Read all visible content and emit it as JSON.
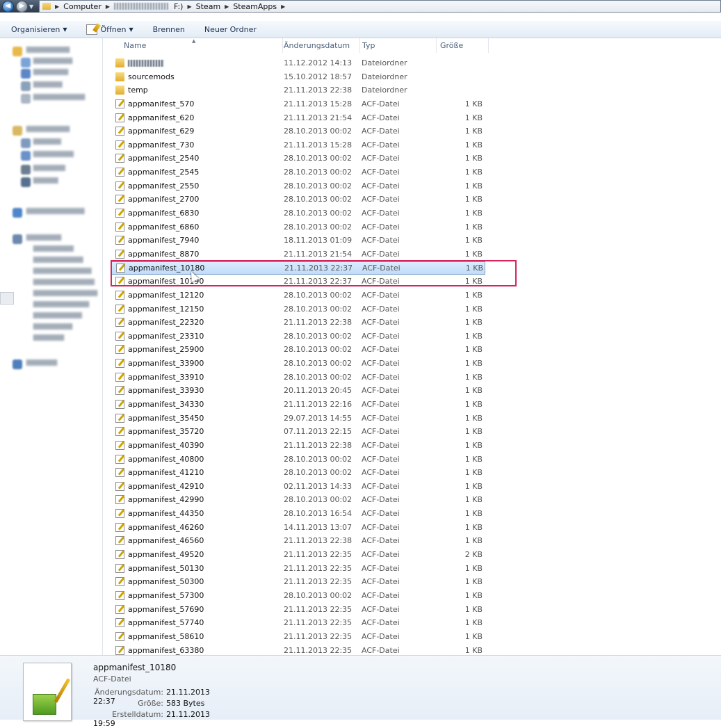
{
  "address": {
    "crumbs": [
      "Computer",
      "F:)",
      "Steam",
      "SteamApps"
    ]
  },
  "toolbar": {
    "organize": "Organisieren",
    "open": "Öffnen",
    "burn": "Brennen",
    "new_folder": "Neuer Ordner"
  },
  "columns": {
    "name": "Name",
    "date": "Änderungsdatum",
    "type": "Typ",
    "size": "Größe"
  },
  "files": [
    {
      "name": "",
      "blurred": true,
      "date": "11.12.2012 14:13",
      "type": "Dateiordner",
      "size": "",
      "kind": "folder"
    },
    {
      "name": "sourcemods",
      "date": "15.10.2012 18:57",
      "type": "Dateiordner",
      "size": "",
      "kind": "folder"
    },
    {
      "name": "temp",
      "date": "21.11.2013 22:38",
      "type": "Dateiordner",
      "size": "",
      "kind": "folder"
    },
    {
      "name": "appmanifest_570",
      "date": "21.11.2013 15:28",
      "type": "ACF-Datei",
      "size": "1 KB",
      "kind": "file"
    },
    {
      "name": "appmanifest_620",
      "date": "21.11.2013 21:54",
      "type": "ACF-Datei",
      "size": "1 KB",
      "kind": "file"
    },
    {
      "name": "appmanifest_629",
      "date": "28.10.2013 00:02",
      "type": "ACF-Datei",
      "size": "1 KB",
      "kind": "file"
    },
    {
      "name": "appmanifest_730",
      "date": "21.11.2013 15:28",
      "type": "ACF-Datei",
      "size": "1 KB",
      "kind": "file"
    },
    {
      "name": "appmanifest_2540",
      "date": "28.10.2013 00:02",
      "type": "ACF-Datei",
      "size": "1 KB",
      "kind": "file"
    },
    {
      "name": "appmanifest_2545",
      "date": "28.10.2013 00:02",
      "type": "ACF-Datei",
      "size": "1 KB",
      "kind": "file"
    },
    {
      "name": "appmanifest_2550",
      "date": "28.10.2013 00:02",
      "type": "ACF-Datei",
      "size": "1 KB",
      "kind": "file"
    },
    {
      "name": "appmanifest_2700",
      "date": "28.10.2013 00:02",
      "type": "ACF-Datei",
      "size": "1 KB",
      "kind": "file"
    },
    {
      "name": "appmanifest_6830",
      "date": "28.10.2013 00:02",
      "type": "ACF-Datei",
      "size": "1 KB",
      "kind": "file"
    },
    {
      "name": "appmanifest_6860",
      "date": "28.10.2013 00:02",
      "type": "ACF-Datei",
      "size": "1 KB",
      "kind": "file"
    },
    {
      "name": "appmanifest_7940",
      "date": "18.11.2013 01:09",
      "type": "ACF-Datei",
      "size": "1 KB",
      "kind": "file"
    },
    {
      "name": "appmanifest_8870",
      "date": "21.11.2013 21:54",
      "type": "ACF-Datei",
      "size": "1 KB",
      "kind": "file"
    },
    {
      "name": "appmanifest_10180",
      "date": "21.11.2013 22:37",
      "type": "ACF-Datei",
      "size": "1 KB",
      "kind": "file",
      "selected": true
    },
    {
      "name": "appmanifest_10190",
      "date": "21.11.2013 22:37",
      "type": "ACF-Datei",
      "size": "1 KB",
      "kind": "file"
    },
    {
      "name": "appmanifest_12120",
      "date": "28.10.2013 00:02",
      "type": "ACF-Datei",
      "size": "1 KB",
      "kind": "file"
    },
    {
      "name": "appmanifest_12150",
      "date": "28.10.2013 00:02",
      "type": "ACF-Datei",
      "size": "1 KB",
      "kind": "file"
    },
    {
      "name": "appmanifest_22320",
      "date": "21.11.2013 22:38",
      "type": "ACF-Datei",
      "size": "1 KB",
      "kind": "file"
    },
    {
      "name": "appmanifest_23310",
      "date": "28.10.2013 00:02",
      "type": "ACF-Datei",
      "size": "1 KB",
      "kind": "file"
    },
    {
      "name": "appmanifest_25900",
      "date": "28.10.2013 00:02",
      "type": "ACF-Datei",
      "size": "1 KB",
      "kind": "file"
    },
    {
      "name": "appmanifest_33900",
      "date": "28.10.2013 00:02",
      "type": "ACF-Datei",
      "size": "1 KB",
      "kind": "file"
    },
    {
      "name": "appmanifest_33910",
      "date": "28.10.2013 00:02",
      "type": "ACF-Datei",
      "size": "1 KB",
      "kind": "file"
    },
    {
      "name": "appmanifest_33930",
      "date": "20.11.2013 20:45",
      "type": "ACF-Datei",
      "size": "1 KB",
      "kind": "file"
    },
    {
      "name": "appmanifest_34330",
      "date": "21.11.2013 22:16",
      "type": "ACF-Datei",
      "size": "1 KB",
      "kind": "file"
    },
    {
      "name": "appmanifest_35450",
      "date": "29.07.2013 14:55",
      "type": "ACF-Datei",
      "size": "1 KB",
      "kind": "file"
    },
    {
      "name": "appmanifest_35720",
      "date": "07.11.2013 22:15",
      "type": "ACF-Datei",
      "size": "1 KB",
      "kind": "file"
    },
    {
      "name": "appmanifest_40390",
      "date": "21.11.2013 22:38",
      "type": "ACF-Datei",
      "size": "1 KB",
      "kind": "file"
    },
    {
      "name": "appmanifest_40800",
      "date": "28.10.2013 00:02",
      "type": "ACF-Datei",
      "size": "1 KB",
      "kind": "file"
    },
    {
      "name": "appmanifest_41210",
      "date": "28.10.2013 00:02",
      "type": "ACF-Datei",
      "size": "1 KB",
      "kind": "file"
    },
    {
      "name": "appmanifest_42910",
      "date": "02.11.2013 14:33",
      "type": "ACF-Datei",
      "size": "1 KB",
      "kind": "file"
    },
    {
      "name": "appmanifest_42990",
      "date": "28.10.2013 00:02",
      "type": "ACF-Datei",
      "size": "1 KB",
      "kind": "file"
    },
    {
      "name": "appmanifest_44350",
      "date": "28.10.2013 16:54",
      "type": "ACF-Datei",
      "size": "1 KB",
      "kind": "file"
    },
    {
      "name": "appmanifest_46260",
      "date": "14.11.2013 13:07",
      "type": "ACF-Datei",
      "size": "1 KB",
      "kind": "file"
    },
    {
      "name": "appmanifest_46560",
      "date": "21.11.2013 22:38",
      "type": "ACF-Datei",
      "size": "1 KB",
      "kind": "file"
    },
    {
      "name": "appmanifest_49520",
      "date": "21.11.2013 22:35",
      "type": "ACF-Datei",
      "size": "2 KB",
      "kind": "file"
    },
    {
      "name": "appmanifest_50130",
      "date": "21.11.2013 22:35",
      "type": "ACF-Datei",
      "size": "1 KB",
      "kind": "file"
    },
    {
      "name": "appmanifest_50300",
      "date": "21.11.2013 22:35",
      "type": "ACF-Datei",
      "size": "1 KB",
      "kind": "file"
    },
    {
      "name": "appmanifest_57300",
      "date": "28.10.2013 00:02",
      "type": "ACF-Datei",
      "size": "1 KB",
      "kind": "file"
    },
    {
      "name": "appmanifest_57690",
      "date": "21.11.2013 22:35",
      "type": "ACF-Datei",
      "size": "1 KB",
      "kind": "file"
    },
    {
      "name": "appmanifest_57740",
      "date": "21.11.2013 22:35",
      "type": "ACF-Datei",
      "size": "1 KB",
      "kind": "file"
    },
    {
      "name": "appmanifest_58610",
      "date": "21.11.2013 22:35",
      "type": "ACF-Datei",
      "size": "1 KB",
      "kind": "file"
    },
    {
      "name": "appmanifest_63380",
      "date": "21.11.2013 22:35",
      "type": "ACF-Datei",
      "size": "1 KB",
      "kind": "file"
    }
  ],
  "details": {
    "name": "appmanifest_10180",
    "type": "ACF-Datei",
    "modified_label": "Änderungsdatum:",
    "modified": "21.11.2013 22:37",
    "size_label": "Größe:",
    "size": "583 Bytes",
    "created_label": "Erstelldatum:",
    "created": "21.11.2013 19:59"
  },
  "colors": {
    "highlight": "#d6245a",
    "selection": "#c1dcfa"
  }
}
